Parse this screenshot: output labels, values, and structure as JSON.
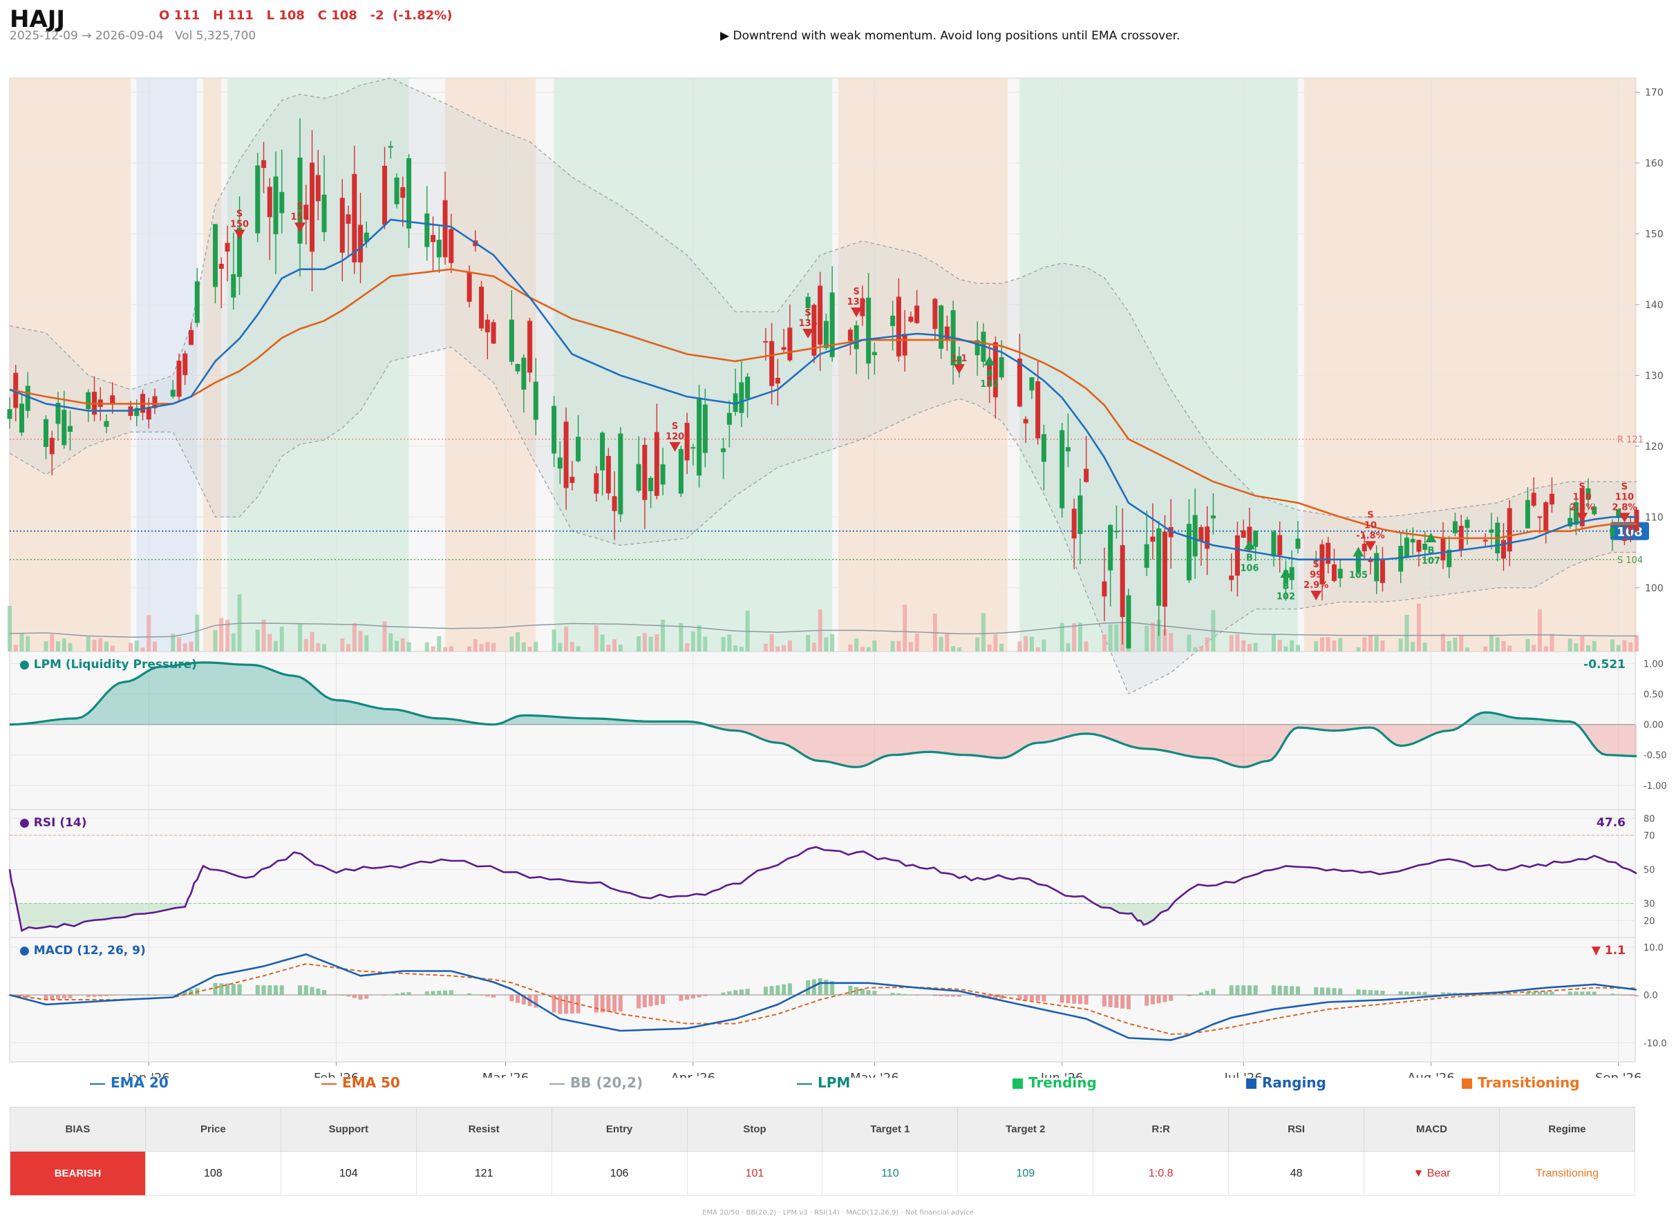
{
  "header": {
    "ticker": "HAJJ",
    "ohlc": "O 111   H 111   L 108   C 108   -2  (-1.82%)",
    "date_range": "2025-12-09 → 2026-09-04",
    "volume": "Vol 5,325,700",
    "note": "▶  Downtrend with weak momentum. Avoid long positions until EMA crossover."
  },
  "colors": {
    "up": "#1e9e4e",
    "down": "#d32f2f",
    "ema20": "#1f6fbf",
    "ema50": "#e0611a",
    "bb": "#9aa3aa",
    "lpm": "#0f8a80",
    "rsi": "#5e1b8f",
    "macd": "#1a5fb4",
    "trending": "#16c25e",
    "ranging": "#1a5fb4",
    "transitioning": "#f0741e"
  },
  "chart_data": [
    {
      "type": "candlestick",
      "title": "",
      "x_range": [
        "2025-12-09",
        "2026-09-04"
      ],
      "x_ticks": [
        "Jan '26",
        "Feb '26",
        "Mar '26",
        "Apr '26",
        "May '26",
        "Jun '26",
        "Jul '26",
        "Aug '26",
        "Sep '26"
      ],
      "y_ticks": [
        100,
        110,
        120,
        130,
        140,
        150,
        160,
        170
      ],
      "ylim": [
        91,
        172
      ],
      "last_close": 108,
      "last_label": "108",
      "resistance": {
        "value": 121,
        "label": "R 121"
      },
      "support": {
        "value": 104,
        "label": "S 104"
      },
      "regimes": [
        {
          "start": "2025-12-09",
          "end": "2025-12-29",
          "kind": "Transitioning"
        },
        {
          "start": "2025-12-30",
          "end": "2026-01-09",
          "kind": "Ranging"
        },
        {
          "start": "2026-01-10",
          "end": "2026-01-13",
          "kind": "Transitioning"
        },
        {
          "start": "2026-01-14",
          "end": "2026-02-13",
          "kind": "Trending"
        },
        {
          "start": "2026-02-19",
          "end": "2026-03-06",
          "kind": "Transitioning"
        },
        {
          "start": "2026-03-09",
          "end": "2026-04-24",
          "kind": "Trending"
        },
        {
          "start": "2026-04-25",
          "end": "2026-05-23",
          "kind": "Transitioning"
        },
        {
          "start": "2026-05-25",
          "end": "2026-07-10",
          "kind": "Trending"
        },
        {
          "start": "2026-07-11",
          "end": "2026-09-04",
          "kind": "Transitioning"
        }
      ],
      "anchors": [
        {
          "d": "2025-12-09",
          "c": 128,
          "e20": 128,
          "e50": 128,
          "bb": 9
        },
        {
          "d": "2025-12-15",
          "c": 121,
          "e20": 126,
          "e50": 127,
          "bb": 10
        },
        {
          "d": "2025-12-22",
          "c": 125,
          "e20": 125,
          "e50": 126,
          "bb": 5
        },
        {
          "d": "2025-12-29",
          "c": 124,
          "e20": 125,
          "e50": 126,
          "bb": 3
        },
        {
          "d": "2026-01-05",
          "c": 128,
          "e20": 126,
          "e50": 126,
          "bb": 4
        },
        {
          "d": "2026-01-08",
          "c": 135,
          "e20": 127,
          "e50": 127,
          "bb": 10
        },
        {
          "d": "2026-01-12",
          "c": 148,
          "e20": 132,
          "e50": 129,
          "bb": 22
        },
        {
          "d": "2026-01-17",
          "c": 150,
          "e20": 136,
          "e50": 131,
          "bb": 26
        },
        {
          "d": "2026-01-24",
          "c": 155,
          "e20": 145,
          "e50": 136,
          "bb": 25
        },
        {
          "d": "2026-01-31",
          "c": 150,
          "e20": 145,
          "e50": 138,
          "bb": 24
        },
        {
          "d": "2026-02-05",
          "c": 152,
          "e20": 148,
          "e50": 141,
          "bb": 23
        },
        {
          "d": "2026-02-10",
          "c": 158,
          "e20": 152,
          "e50": 144,
          "bb": 20
        },
        {
          "d": "2026-02-20",
          "c": 150,
          "e20": 151,
          "e50": 145,
          "bb": 17
        },
        {
          "d": "2026-02-27",
          "c": 140,
          "e20": 147,
          "e50": 144,
          "bb": 18
        },
        {
          "d": "2026-03-05",
          "c": 133,
          "e20": 141,
          "e50": 141,
          "bb": 22
        },
        {
          "d": "2026-03-12",
          "c": 120,
          "e20": 133,
          "e50": 138,
          "bb": 25
        },
        {
          "d": "2026-03-20",
          "c": 118,
          "e20": 130,
          "e50": 136,
          "bb": 24
        },
        {
          "d": "2026-03-31",
          "c": 120,
          "e20": 127,
          "e50": 133,
          "bb": 20
        },
        {
          "d": "2026-04-08",
          "c": 125,
          "e20": 126,
          "e50": 132,
          "bb": 13
        },
        {
          "d": "2026-04-15",
          "c": 133,
          "e20": 128,
          "e50": 133,
          "bb": 11
        },
        {
          "d": "2026-04-22",
          "c": 138,
          "e20": 133,
          "e50": 134,
          "bb": 14
        },
        {
          "d": "2026-04-29",
          "c": 136,
          "e20": 135,
          "e50": 135,
          "bb": 14
        },
        {
          "d": "2026-05-09",
          "c": 138,
          "e20": 136,
          "e50": 135,
          "bb": 11
        },
        {
          "d": "2026-05-16",
          "c": 134,
          "e20": 135,
          "e50": 135,
          "bb": 8
        },
        {
          "d": "2026-05-23",
          "c": 130,
          "e20": 133,
          "e50": 134,
          "bb": 10
        },
        {
          "d": "2026-05-31",
          "c": 120,
          "e20": 128,
          "e50": 131,
          "bb": 18
        },
        {
          "d": "2026-06-07",
          "c": 106,
          "e20": 120,
          "e50": 127,
          "bb": 25
        },
        {
          "d": "2026-06-12",
          "c": 100,
          "e20": 112,
          "e50": 121,
          "bb": 27
        },
        {
          "d": "2026-06-19",
          "c": 104,
          "e20": 108,
          "e50": 118,
          "bb": 20
        },
        {
          "d": "2026-06-26",
          "c": 106,
          "e20": 106,
          "e50": 115,
          "bb": 13
        },
        {
          "d": "2026-07-03",
          "c": 105,
          "e20": 105,
          "e50": 113,
          "bb": 8
        },
        {
          "d": "2026-07-10",
          "c": 104,
          "e20": 104,
          "e50": 112,
          "bb": 7
        },
        {
          "d": "2026-07-17",
          "c": 103,
          "e20": 104,
          "e50": 110,
          "bb": 6
        },
        {
          "d": "2026-07-25",
          "c": 104,
          "e20": 104,
          "e50": 108,
          "bb": 6
        },
        {
          "d": "2026-08-03",
          "c": 106,
          "e20": 105,
          "e50": 107,
          "bb": 6
        },
        {
          "d": "2026-08-12",
          "c": 107,
          "e20": 106,
          "e50": 107,
          "bb": 6
        },
        {
          "d": "2026-08-18",
          "c": 110,
          "e20": 107,
          "e50": 108,
          "bb": 7
        },
        {
          "d": "2026-08-24",
          "c": 112,
          "e20": 109,
          "e50": 108,
          "bb": 6
        },
        {
          "d": "2026-08-30",
          "c": 110,
          "e20": 110,
          "e50": 109,
          "bb": 5
        },
        {
          "d": "2026-09-04",
          "c": 108,
          "e20": 110,
          "e50": 109,
          "bb": 5
        }
      ],
      "signals": [
        {
          "d": "2026-01-16",
          "kind": "S",
          "price": 150,
          "label": "S\n150"
        },
        {
          "d": "2026-01-26",
          "kind": "S",
          "price": 151,
          "label": "S\n151"
        },
        {
          "d": "2026-03-29",
          "kind": "S",
          "price": 120,
          "label": "S\n120"
        },
        {
          "d": "2026-04-20",
          "kind": "S",
          "price": 136,
          "label": "S\n136"
        },
        {
          "d": "2026-04-28",
          "kind": "S",
          "price": 139,
          "label": "S\n139"
        },
        {
          "d": "2026-05-15",
          "kind": "S",
          "price": 131,
          "label": "1.1"
        },
        {
          "d": "2026-05-20",
          "kind": "B",
          "price": 132,
          "label": "B\n132"
        },
        {
          "d": "2026-07-02",
          "kind": "B",
          "price": 106,
          "label": "B\n106"
        },
        {
          "d": "2026-07-08",
          "kind": "B",
          "price": 102,
          "label": "B\n102"
        },
        {
          "d": "2026-07-13",
          "kind": "S",
          "price": 99,
          "label": "S\n99\n2.9%"
        },
        {
          "d": "2026-07-20",
          "kind": "B",
          "price": 105,
          "label": "B\n105"
        },
        {
          "d": "2026-07-22",
          "kind": "S",
          "price": 106,
          "label": "S\n10\n-1.8%"
        },
        {
          "d": "2026-08-01",
          "kind": "B",
          "price": 107,
          "label": "B\n107"
        },
        {
          "d": "2026-08-26",
          "kind": "S",
          "price": 110,
          "label": "S\n110\n2.8%"
        },
        {
          "d": "2026-09-02",
          "kind": "S",
          "price": 110,
          "label": "S\n110\n2.8%"
        }
      ]
    },
    {
      "type": "area",
      "title": "● LPM (Liquidity Pressure)",
      "last_label": "-0.521",
      "y_ticks": [
        1.0,
        0.5,
        0.0,
        -0.5,
        -1.0
      ],
      "y_tick_labels": [
        "1.00",
        "0.50",
        "0.00",
        "-0.50",
        "-1.00"
      ],
      "ylim": [
        -1.4,
        1.2
      ],
      "x": [
        "2025-12-09",
        "2025-12-20",
        "2025-12-28",
        "2026-01-03",
        "2026-01-10",
        "2026-01-18",
        "2026-01-25",
        "2026-02-01",
        "2026-02-10",
        "2026-02-18",
        "2026-02-27",
        "2026-03-04",
        "2026-03-15",
        "2026-03-25",
        "2026-03-31",
        "2026-04-08",
        "2026-04-15",
        "2026-04-22",
        "2026-04-28",
        "2026-05-04",
        "2026-05-10",
        "2026-05-16",
        "2026-05-22",
        "2026-05-28",
        "2026-06-05",
        "2026-06-15",
        "2026-06-25",
        "2026-07-01",
        "2026-07-05",
        "2026-07-10",
        "2026-07-16",
        "2026-07-22",
        "2026-07-27",
        "2026-08-04",
        "2026-08-10",
        "2026-08-16",
        "2026-08-24",
        "2026-08-30",
        "2026-09-04"
      ],
      "y": [
        0.0,
        0.1,
        0.7,
        0.95,
        1.02,
        0.98,
        0.8,
        0.4,
        0.25,
        0.1,
        0.0,
        0.15,
        0.1,
        0.05,
        0.05,
        -0.1,
        -0.3,
        -0.6,
        -0.7,
        -0.5,
        -0.45,
        -0.5,
        -0.55,
        -0.3,
        -0.15,
        -0.4,
        -0.55,
        -0.7,
        -0.6,
        -0.05,
        -0.1,
        -0.05,
        -0.35,
        -0.1,
        0.2,
        0.1,
        0.05,
        -0.5,
        -0.52
      ]
    },
    {
      "type": "line",
      "title": "● RSI (14)",
      "last_label": "47.6",
      "y_ticks": [
        80,
        70,
        50,
        30,
        20
      ],
      "ylim": [
        10,
        85
      ],
      "overbought": 70,
      "oversold": 30,
      "x": [
        "2025-12-09",
        "2025-12-11",
        "2025-12-18",
        "2025-12-28",
        "2026-01-07",
        "2026-01-10",
        "2026-01-17",
        "2026-01-25",
        "2026-02-01",
        "2026-02-10",
        "2026-02-20",
        "2026-03-05",
        "2026-03-15",
        "2026-03-25",
        "2026-04-03",
        "2026-04-10",
        "2026-04-20",
        "2026-04-28",
        "2026-05-05",
        "2026-05-12",
        "2026-05-18",
        "2026-05-25",
        "2026-06-03",
        "2026-06-12",
        "2026-06-15",
        "2026-06-22",
        "2026-07-01",
        "2026-07-08",
        "2026-07-16",
        "2026-07-25",
        "2026-08-04",
        "2026-08-12",
        "2026-08-20",
        "2026-08-28",
        "2026-09-04"
      ],
      "y": [
        50,
        14,
        18,
        22,
        28,
        52,
        45,
        60,
        48,
        52,
        55,
        45,
        42,
        33,
        35,
        45,
        62,
        60,
        55,
        48,
        45,
        45,
        34,
        24,
        18,
        38,
        45,
        52,
        50,
        48,
        56,
        50,
        52,
        58,
        47.6
      ]
    },
    {
      "type": "line",
      "title": "● MACD (12, 26, 9)",
      "last_label": "▼ 1.1",
      "y_ticks": [
        10.0,
        0.0,
        -10.0
      ],
      "y_tick_labels": [
        "10.0",
        "0.0",
        "-10.0"
      ],
      "ylim": [
        -14,
        12
      ],
      "x": [
        "2025-12-09",
        "2025-12-15",
        "2025-12-28",
        "2026-01-05",
        "2026-01-12",
        "2026-01-20",
        "2026-01-27",
        "2026-02-05",
        "2026-02-12",
        "2026-02-20",
        "2026-03-01",
        "2026-03-10",
        "2026-03-20",
        "2026-03-31",
        "2026-04-08",
        "2026-04-15",
        "2026-04-22",
        "2026-04-30",
        "2026-05-08",
        "2026-05-15",
        "2026-05-25",
        "2026-06-05",
        "2026-06-12",
        "2026-06-20",
        "2026-06-28",
        "2026-07-06",
        "2026-07-15",
        "2026-07-25",
        "2026-08-04",
        "2026-08-12",
        "2026-08-20",
        "2026-08-28",
        "2026-09-04"
      ],
      "macd": [
        0,
        -2,
        -1,
        -0.5,
        4,
        6,
        8.5,
        4,
        5,
        5,
        2,
        -5,
        -7.5,
        -7,
        -5,
        -2,
        2.5,
        2.5,
        1.5,
        0.8,
        -2,
        -5,
        -9,
        -9.5,
        -5,
        -3,
        -1.5,
        -1,
        0,
        0.5,
        1.5,
        2.2,
        1.1
      ],
      "signal": [
        0,
        -1,
        -1,
        -0.5,
        1.5,
        4,
        6.5,
        5,
        4.5,
        4,
        3,
        -1,
        -4,
        -6,
        -6,
        -4,
        -1,
        1.5,
        1.6,
        1.2,
        -1,
        -3,
        -6,
        -8.5,
        -7,
        -5,
        -3,
        -1.8,
        -0.5,
        0.3,
        0.8,
        1.5,
        1.4
      ]
    }
  ],
  "legend": [
    {
      "label": "EMA 20",
      "kind": "line",
      "color": "#1f6fbf"
    },
    {
      "label": "EMA 50",
      "kind": "line",
      "color": "#e0611a"
    },
    {
      "label": "BB (20,2)",
      "kind": "line",
      "color": "#9aa3aa"
    },
    {
      "label": "LPM",
      "kind": "line",
      "color": "#0f8a80"
    },
    {
      "label": "Trending",
      "kind": "square",
      "color": "#16c25e"
    },
    {
      "label": "Ranging",
      "kind": "square",
      "color": "#1a5fb4"
    },
    {
      "label": "Transitioning",
      "kind": "square",
      "color": "#f0741e"
    }
  ],
  "summary": {
    "headers": [
      "BIAS",
      "Price",
      "Support",
      "Resist",
      "Entry",
      "Stop",
      "Target 1",
      "Target 2",
      "R:R",
      "RSI",
      "MACD",
      "Regime"
    ],
    "values": [
      "BEARISH",
      "108",
      "104",
      "121",
      "106",
      "101",
      "110",
      "109",
      "1:0.8",
      "48",
      "▼ Bear",
      "Transitioning"
    ],
    "value_colors": [
      "#ffffff",
      "#222222",
      "#222222",
      "#222222",
      "#222222",
      "#d32f2f",
      "#0f8a80",
      "#0f8a80",
      "#d32f2f",
      "#222222",
      "#d32f2f",
      "#f0741e"
    ]
  },
  "footer": "EMA 20/50  ·  BB(20,2)  ·  LPM v3  ·  RSI(14)  ·  MACD(12,26,9)  ·  Not financial advice"
}
